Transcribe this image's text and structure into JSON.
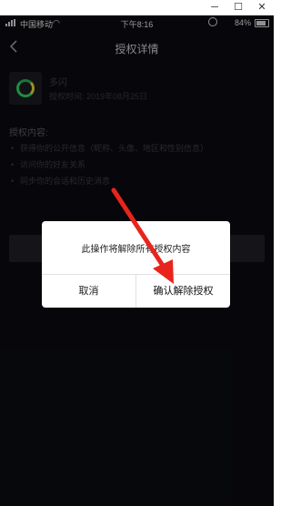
{
  "window": {
    "minimize_glyph": "─",
    "maximize_glyph": "☐",
    "close_glyph": "✕"
  },
  "status_bar": {
    "carrier": "中国移动",
    "time": "下午8:16",
    "battery": "84%"
  },
  "nav": {
    "title": "授权详情"
  },
  "app": {
    "name": "多闪",
    "authorized_date": "授权时间: 2019年08月25日"
  },
  "scope": {
    "title": "授权内容:",
    "items": [
      "获得你的公开信息（昵称、头像、地区和性别信息）",
      "访问你的好友关系",
      "同步你的会话和历史消息"
    ]
  },
  "dialog": {
    "message": "此操作将解除所有授权内容",
    "cancel_label": "取消",
    "confirm_label": "确认解除授权"
  },
  "colors": {
    "screen_bg": "#0b0c11",
    "annotation_arrow": "#e8241c"
  },
  "icons": {
    "back": "chevron-left-icon",
    "wifi": "wifi-icon",
    "alarm": "alarm-icon",
    "battery": "battery-icon",
    "app_logo": "duoshan-logo-icon"
  }
}
